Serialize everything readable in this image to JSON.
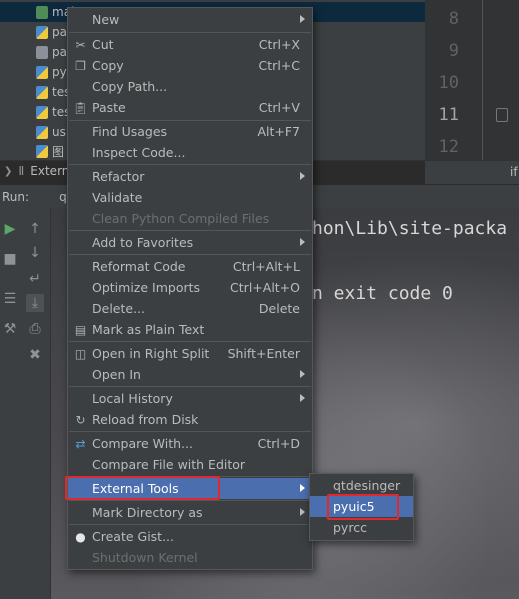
{
  "project": {
    "files": [
      {
        "name": "mai",
        "icon": "exe-file-icon"
      },
      {
        "name": "pa",
        "icon": "python-file-icon"
      },
      {
        "name": "pa",
        "icon": "text-file-icon"
      },
      {
        "name": "py",
        "icon": "python-file-icon"
      },
      {
        "name": "tes",
        "icon": "python-file-icon"
      },
      {
        "name": "tes",
        "icon": "python-file-icon"
      },
      {
        "name": "us",
        "icon": "python-file-icon"
      },
      {
        "name": "图",
        "icon": "python-file-icon"
      }
    ],
    "external_libraries": "Extern"
  },
  "editor": {
    "line_numbers": [
      "8",
      "9",
      "10",
      "11",
      "12"
    ],
    "current_line": "11",
    "tab_fragment": "if"
  },
  "run": {
    "label": "Run:",
    "tab": "q",
    "console_lines": [
      "hon\\Lib\\site-packa",
      "n exit code 0"
    ]
  },
  "context_menu": {
    "items": [
      {
        "label": "New",
        "shortcut": "",
        "submenu": true
      },
      {
        "separator": true
      },
      {
        "label": "Cut",
        "shortcut": "Ctrl+X",
        "icon": "scissors-icon"
      },
      {
        "label": "Copy",
        "shortcut": "Ctrl+C",
        "icon": "copy-icon"
      },
      {
        "label": "Copy Path...",
        "shortcut": ""
      },
      {
        "label": "Paste",
        "shortcut": "Ctrl+V",
        "icon": "clipboard-icon"
      },
      {
        "separator": true
      },
      {
        "label": "Find Usages",
        "shortcut": "Alt+F7"
      },
      {
        "label": "Inspect Code...",
        "shortcut": ""
      },
      {
        "separator": true
      },
      {
        "label": "Refactor",
        "shortcut": "",
        "submenu": true
      },
      {
        "label": "Validate",
        "shortcut": ""
      },
      {
        "label": "Clean Python Compiled Files",
        "shortcut": "",
        "disabled": true
      },
      {
        "separator": true
      },
      {
        "label": "Add to Favorites",
        "shortcut": "",
        "submenu": true
      },
      {
        "separator": true
      },
      {
        "label": "Reformat Code",
        "shortcut": "Ctrl+Alt+L"
      },
      {
        "label": "Optimize Imports",
        "shortcut": "Ctrl+Alt+O"
      },
      {
        "label": "Delete...",
        "shortcut": "Delete"
      },
      {
        "label": "Mark as Plain Text",
        "shortcut": "",
        "icon": "plain-text-icon"
      },
      {
        "separator": true
      },
      {
        "label": "Open in Right Split",
        "shortcut": "Shift+Enter",
        "icon": "split-icon"
      },
      {
        "label": "Open In",
        "shortcut": "",
        "submenu": true
      },
      {
        "separator": true
      },
      {
        "label": "Local History",
        "shortcut": "",
        "submenu": true
      },
      {
        "label": "Reload from Disk",
        "shortcut": "",
        "icon": "reload-icon"
      },
      {
        "separator": true
      },
      {
        "label": "Compare With...",
        "shortcut": "Ctrl+D",
        "icon": "compare-icon"
      },
      {
        "label": "Compare File with Editor",
        "shortcut": ""
      },
      {
        "separator": true
      },
      {
        "label": "External Tools",
        "shortcut": "",
        "submenu": true,
        "active": true
      },
      {
        "separator": true
      },
      {
        "label": "Mark Directory as",
        "shortcut": "",
        "submenu": true
      },
      {
        "separator": true
      },
      {
        "label": "Create Gist...",
        "shortcut": "",
        "icon": "github-icon"
      },
      {
        "label": "Shutdown Kernel",
        "shortcut": "",
        "disabled": true
      }
    ]
  },
  "external_tools_submenu": {
    "items": [
      {
        "label": "qtdesinger"
      },
      {
        "label": "pyuic5",
        "active": true
      },
      {
        "label": "pyrcc"
      }
    ]
  },
  "colors": {
    "menu_bg": "#3c3f41",
    "active_bg": "#4b6eaf",
    "highlight_red": "#e0292f"
  }
}
